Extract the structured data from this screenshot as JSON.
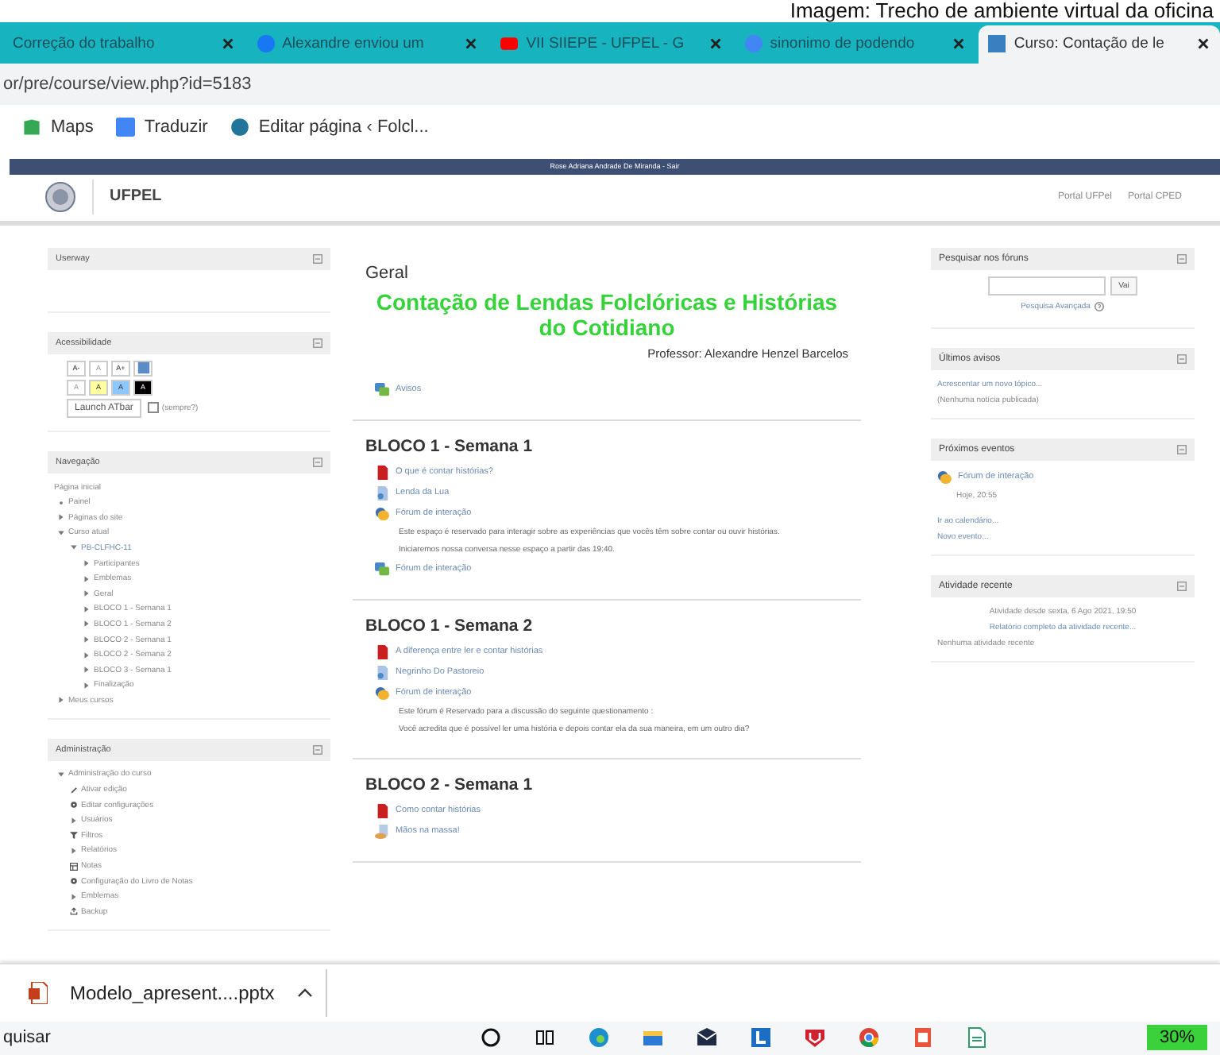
{
  "caption": "Imagem: Trecho de ambiente virtual da oficina",
  "tabs": [
    {
      "title": "Correção do trabalho",
      "selected": false
    },
    {
      "title": "Alexandre enviou um",
      "selected": false
    },
    {
      "title": "VII SIIEPE - UFPEL - G",
      "selected": false
    },
    {
      "title": "sinonimo de podendo",
      "selected": false
    },
    {
      "title": "Curso: Contação de le",
      "selected": true
    }
  ],
  "address": "or/pre/course/view.php?id=5183",
  "bookmarks": [
    "Maps",
    "Traduzir",
    "Editar página ‹ Folcl..."
  ],
  "user_bar": "Rose Adriana Andrade De Miranda - Sair",
  "header": {
    "site": "UFPEL",
    "links": [
      "Portal UFPel",
      "Portal CPED"
    ]
  },
  "left_blocks": [
    {
      "kind": "userway",
      "title": "Userway"
    },
    {
      "kind": "accessibility",
      "title": "Acessibilidade",
      "rows": [
        [
          {
            "label": "A-",
            "kind": "plain",
            "disabled": false
          },
          {
            "label": "A",
            "kind": "plain",
            "disabled": true
          },
          {
            "label": "A+",
            "kind": "plain",
            "disabled": false
          },
          {
            "kind": "icon"
          }
        ],
        [
          {
            "label": "A",
            "kind": "plain",
            "disabled": true
          },
          {
            "label": "A",
            "kind": "yellow",
            "disabled": false
          },
          {
            "label": "A",
            "kind": "blue",
            "disabled": false
          },
          {
            "label": "A",
            "kind": "black",
            "disabled": false
          }
        ]
      ],
      "launch": "Launch ATbar",
      "always": {
        "label": "(sempre?)",
        "checked": false
      }
    },
    {
      "kind": "navigation",
      "title": "Navegação",
      "home": "Página inicial",
      "items": [
        {
          "label": "Painel",
          "kind": "bullet"
        },
        {
          "label": "Páginas do site",
          "kind": "branch",
          "expanded": false
        },
        {
          "label": "Curso atual",
          "kind": "branch",
          "expanded": true,
          "children": [
            {
              "label": "PB-CLFHC-11",
              "kind": "branch",
              "expanded": true,
              "link": true,
              "children": [
                {
                  "label": "Participantes",
                  "kind": "branch",
                  "expanded": false
                },
                {
                  "label": "Emblemas",
                  "kind": "branch",
                  "expanded": false
                },
                {
                  "label": "Geral",
                  "kind": "branch",
                  "expanded": false
                },
                {
                  "label": "BLOCO 1 - Semana 1",
                  "kind": "branch",
                  "expanded": false
                },
                {
                  "label": "BLOCO 1 - Semana 2",
                  "kind": "branch",
                  "expanded": false
                },
                {
                  "label": "BLOCO 2 - Semana 1",
                  "kind": "branch",
                  "expanded": false
                },
                {
                  "label": "BLOCO 2 - Semana 2",
                  "kind": "branch",
                  "expanded": false
                },
                {
                  "label": "BLOCO 3 - Semana 1",
                  "kind": "branch",
                  "expanded": false
                },
                {
                  "label": "Finalização",
                  "kind": "branch",
                  "expanded": false
                }
              ]
            }
          ]
        },
        {
          "label": "Meus cursos",
          "kind": "branch",
          "expanded": false
        }
      ]
    },
    {
      "kind": "administration",
      "title": "Administração",
      "items": [
        {
          "label": "Administração do curso",
          "kind": "branch",
          "expanded": true,
          "children": [
            {
              "label": "Ativar edição",
              "kind": "pencil"
            },
            {
              "label": "Editar configurações",
              "kind": "gear"
            },
            {
              "label": "Usuários",
              "kind": "branch",
              "expanded": false
            },
            {
              "label": "Filtros",
              "kind": "filter"
            },
            {
              "label": "Relatórios",
              "kind": "branch",
              "expanded": false
            },
            {
              "label": "Notas",
              "kind": "grid"
            },
            {
              "label": "Configuração do Livro de Notas",
              "kind": "gear"
            },
            {
              "label": "Emblemas",
              "kind": "branch",
              "expanded": false
            },
            {
              "label": "Backup",
              "kind": "backup"
            }
          ]
        }
      ]
    }
  ],
  "sections": [
    {
      "title": "Geral",
      "heading": "Contação de Lendas Folclóricas e Histórias do Cotidiano",
      "teacher": "Professor: Alexandre Henzel Barcelos",
      "activities": [
        {
          "label": "Avisos",
          "kind": "forum"
        }
      ]
    },
    {
      "title": "BLOCO 1 - Semana 1",
      "activities": [
        {
          "label": "O que é contar histórias?",
          "kind": "pdf"
        },
        {
          "label": "Lenda da Lua",
          "kind": "page"
        },
        {
          "label": "Fórum de interação",
          "kind": "chat",
          "description": [
            "Este espaço é reservado para interagir sobre as experiências que vocês têm sobre contar ou ouvir histórias.",
            "Iniciaremos nossa conversa nesse espaço a partir das 19:40."
          ]
        },
        {
          "label": "Fórum de interação",
          "kind": "forum"
        }
      ]
    },
    {
      "title": "BLOCO 1 - Semana 2",
      "activities": [
        {
          "label": "A diferença entre ler e contar histórias",
          "kind": "pdf"
        },
        {
          "label": "Negrinho Do Pastoreio",
          "kind": "page"
        },
        {
          "label": "Fórum de interação",
          "kind": "chat",
          "description": [
            "Este fórum é Reservado para a discussão do seguinte questionamento :",
            "Você acredita que é possível ler uma história e depois contar ela da sua maneira, em um outro dia?"
          ]
        }
      ]
    },
    {
      "title": "BLOCO 2 - Semana 1",
      "activities": [
        {
          "label": "Como contar histórias",
          "kind": "pdf"
        },
        {
          "label": "Mãos na massa!",
          "kind": "lesson"
        }
      ]
    }
  ],
  "right_blocks": [
    {
      "kind": "search",
      "title": "Pesquisar nos fóruns",
      "button": "Vai",
      "advanced": "Pesquisa Avançada"
    },
    {
      "kind": "news",
      "title": "Últimos avisos",
      "add": "Acrescentar um novo tópico...",
      "empty": "(Nenhuma notícia publicada)"
    },
    {
      "kind": "events",
      "title": "Próximos eventos",
      "event": "Fórum de interação",
      "when": "Hoje, 20:55",
      "links": [
        "Ir ao calendário...",
        "Novo evento..."
      ]
    },
    {
      "kind": "recent",
      "title": "Atividade recente",
      "since": "Atividade desde sexta, 6 Ago 2021, 19:50",
      "report": "Relatório completo da atividade recente...",
      "empty": "Nenhuma atividade recente"
    }
  ],
  "download": {
    "file": "Modelo_apresent....pptx"
  },
  "taskbar": {
    "search": "quisar",
    "battery": "30%"
  }
}
